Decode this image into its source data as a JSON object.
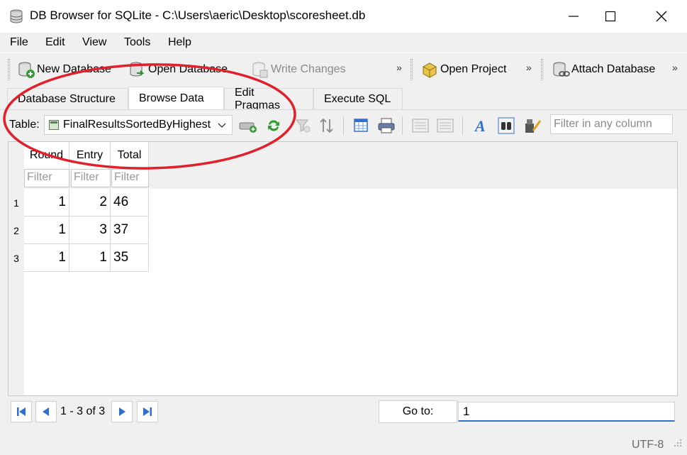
{
  "window": {
    "title": "DB Browser for SQLite - C:\\Users\\aeric\\Desktop\\scoresheet.db"
  },
  "menu": [
    "File",
    "Edit",
    "View",
    "Tools",
    "Help"
  ],
  "toolbar": {
    "new_database": "New Database",
    "open_database": "Open Database",
    "write_changes": "Write Changes",
    "open_project": "Open Project",
    "attach_database": "Attach Database",
    "overflow": "»"
  },
  "tabs": [
    "Database Structure",
    "Browse Data",
    "Edit Pragmas",
    "Execute SQL"
  ],
  "active_tab": "Browse Data",
  "browse": {
    "table_label": "Table:",
    "table_name": "FinalResultsSortedByHighest",
    "filter_any_placeholder": "Filter in any column",
    "columns": [
      "Round",
      "Entry",
      "Total"
    ],
    "filter_placeholder": "Filter",
    "rows": [
      {
        "num": "1",
        "round": "1",
        "entry": "2",
        "total": "46"
      },
      {
        "num": "2",
        "round": "1",
        "entry": "3",
        "total": "37"
      },
      {
        "num": "3",
        "round": "1",
        "entry": "1",
        "total": "35"
      }
    ]
  },
  "nav": {
    "status": "1 - 3 of 3",
    "goto_label": "Go to:",
    "goto_value": "1"
  },
  "statusbar": {
    "encoding": "UTF-8"
  },
  "colors": {
    "annotation": "#e0202a",
    "accent": "#2f6fd1"
  }
}
